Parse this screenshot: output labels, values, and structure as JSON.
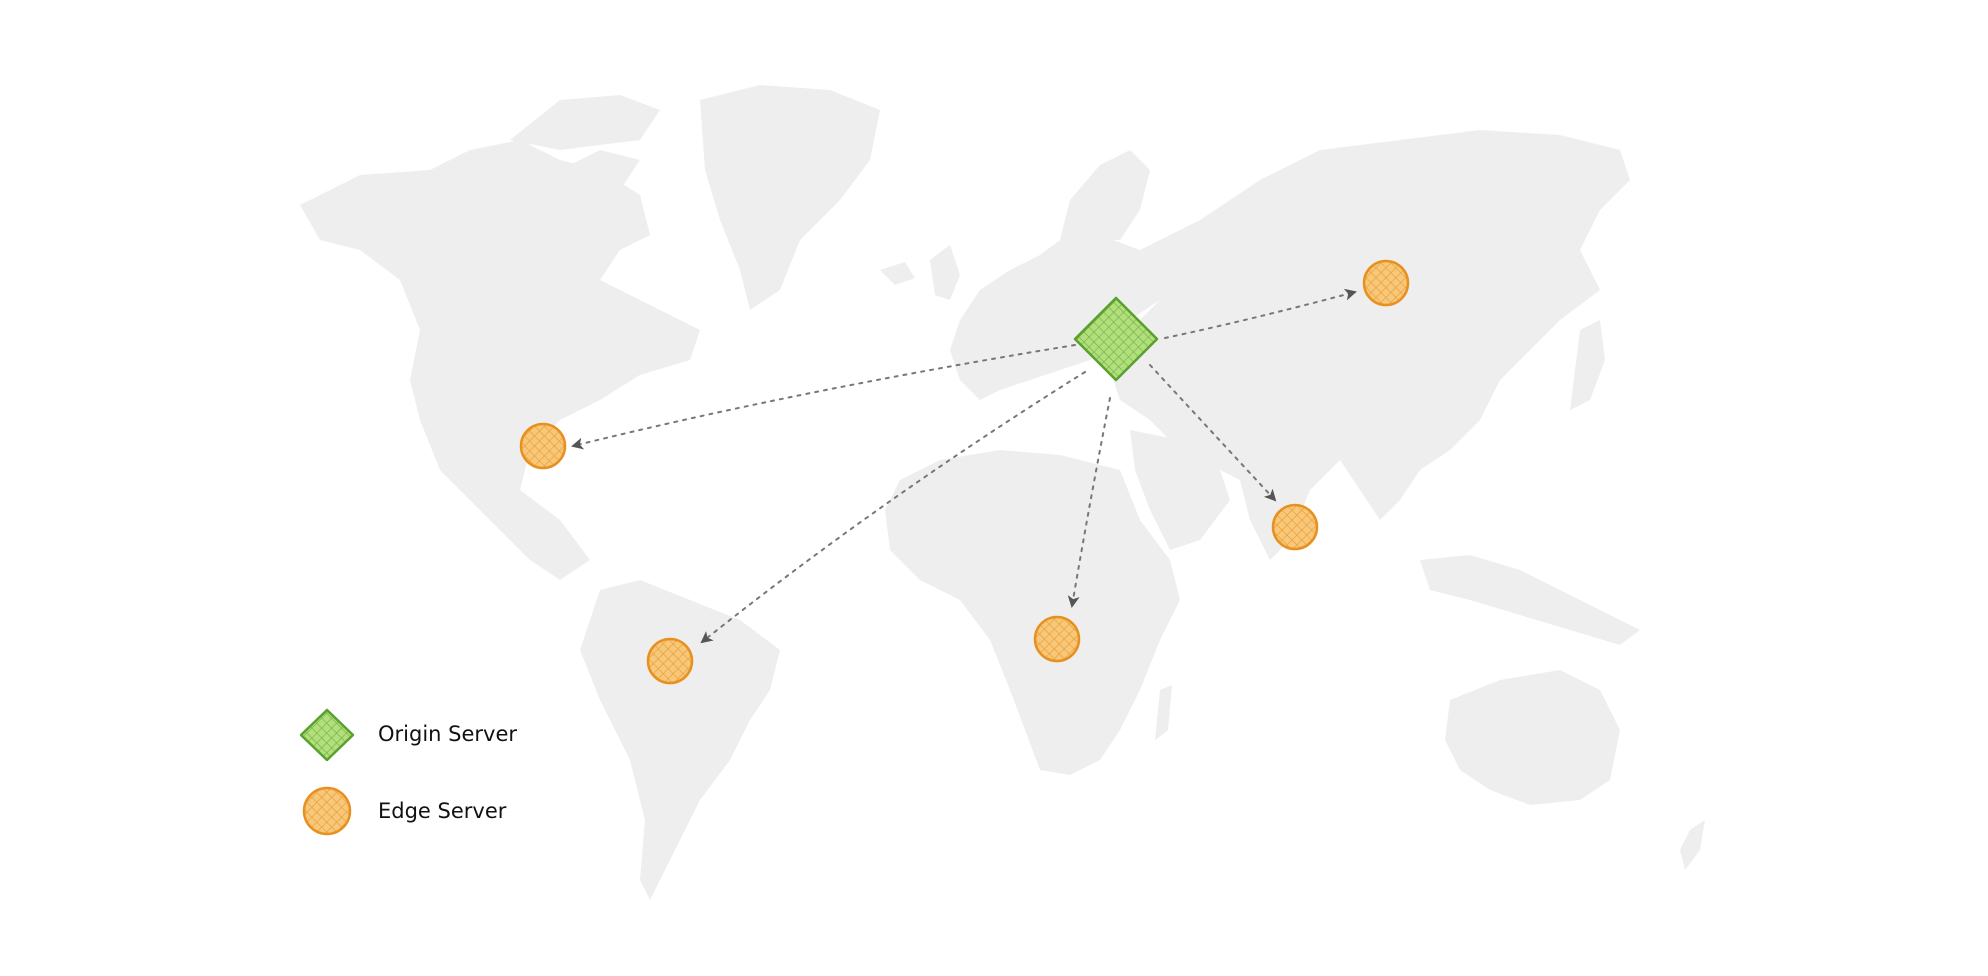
{
  "colors": {
    "background": "#ffffff",
    "land": "#eeeeee",
    "origin_fill": "#b2de7e",
    "origin_stroke": "#5aa02c",
    "edge_fill": "#f7c77a",
    "edge_stroke": "#e8901f",
    "connector": "#777777",
    "arrowhead": "#555555",
    "text": "#111111"
  },
  "legend": {
    "origin_label": "Origin Server",
    "edge_label": "Edge Server"
  },
  "nodes": {
    "origin": {
      "type": "origin",
      "location": "Europe"
    },
    "edges": [
      {
        "location": "Russia / East Asia"
      },
      {
        "location": "North America"
      },
      {
        "location": "South America"
      },
      {
        "location": "Central Africa"
      },
      {
        "location": "India"
      }
    ]
  },
  "connections": [
    {
      "from": "origin",
      "to": "Russia / East Asia",
      "style": "dotted-arrow"
    },
    {
      "from": "origin",
      "to": "North America",
      "style": "dotted-arrow"
    },
    {
      "from": "origin",
      "to": "South America",
      "style": "dotted-arrow"
    },
    {
      "from": "origin",
      "to": "Central Africa",
      "style": "dotted-arrow"
    },
    {
      "from": "origin",
      "to": "India",
      "style": "dotted-arrow"
    }
  ]
}
